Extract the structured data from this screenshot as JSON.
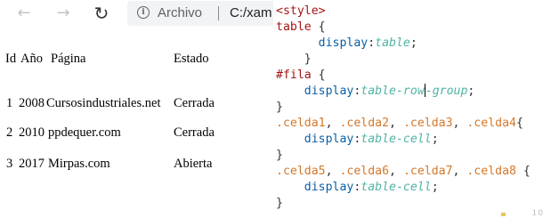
{
  "browser": {
    "back_icon": "←",
    "forward_icon": "→",
    "reload_icon": "↻",
    "info_icon": "i",
    "address_label": "Archivo",
    "address_separator": "|",
    "url": "C:/xam"
  },
  "table": {
    "headers": [
      "Id",
      "Año",
      "Página",
      "Estado"
    ],
    "rows": [
      {
        "id": "1",
        "year": "2008",
        "page": "Cursosindustriales.net",
        "status": "Cerrada"
      },
      {
        "id": "2",
        "year": "2010",
        "page": "ppdequer.com",
        "status": "Cerrada"
      },
      {
        "id": "3",
        "year": "2017",
        "page": "Mirpas.com",
        "status": "Abierta"
      }
    ]
  },
  "editor": {
    "lines": [
      {
        "parts": [
          [
            "tag",
            "<style>"
          ]
        ]
      },
      {
        "parts": [
          [
            "sel",
            "table"
          ],
          [
            "punc",
            " {"
          ]
        ]
      },
      {
        "parts": [
          [
            "punc",
            "      "
          ],
          [
            "prop",
            "display"
          ],
          [
            "punc",
            ":"
          ],
          [
            "val",
            "table"
          ],
          [
            "punc",
            ";"
          ]
        ]
      },
      {
        "parts": [
          [
            "punc",
            "    }"
          ]
        ]
      },
      {
        "parts": [
          [
            "sel",
            "#fila"
          ],
          [
            "punc",
            " {"
          ]
        ]
      },
      {
        "parts": [
          [
            "punc",
            "    "
          ],
          [
            "prop",
            "display"
          ],
          [
            "punc",
            ":"
          ],
          [
            "val",
            "table-row-group"
          ],
          [
            "punc",
            ";"
          ]
        ]
      },
      {
        "parts": [
          [
            "punc",
            "}"
          ]
        ]
      },
      {
        "parts": [
          [
            "cls",
            ".celda1"
          ],
          [
            "punc",
            ", "
          ],
          [
            "cls",
            ".celda2"
          ],
          [
            "punc",
            ", "
          ],
          [
            "cls",
            ".celda3"
          ],
          [
            "punc",
            ", "
          ],
          [
            "cls",
            ".celda4"
          ],
          [
            "punc",
            "{"
          ]
        ]
      },
      {
        "parts": [
          [
            "punc",
            "    "
          ],
          [
            "prop",
            "display"
          ],
          [
            "punc",
            ":"
          ],
          [
            "val",
            "table-cell"
          ],
          [
            "punc",
            ";"
          ]
        ]
      },
      {
        "parts": [
          [
            "punc",
            "}"
          ]
        ]
      },
      {
        "parts": [
          [
            "cls",
            ".celda5"
          ],
          [
            "punc",
            ", "
          ],
          [
            "cls",
            ".celda6"
          ],
          [
            "punc",
            ", "
          ],
          [
            "cls",
            ".celda7"
          ],
          [
            "punc",
            ", "
          ],
          [
            "cls",
            ".celda8"
          ],
          [
            "punc",
            " {"
          ]
        ]
      },
      {
        "parts": [
          [
            "punc",
            "    "
          ],
          [
            "prop",
            "display"
          ],
          [
            "punc",
            ":"
          ],
          [
            "val",
            "table-cell"
          ],
          [
            "punc",
            ";"
          ]
        ]
      },
      {
        "parts": [
          [
            "punc",
            "}"
          ]
        ]
      }
    ]
  },
  "footer_marks": "10"
}
